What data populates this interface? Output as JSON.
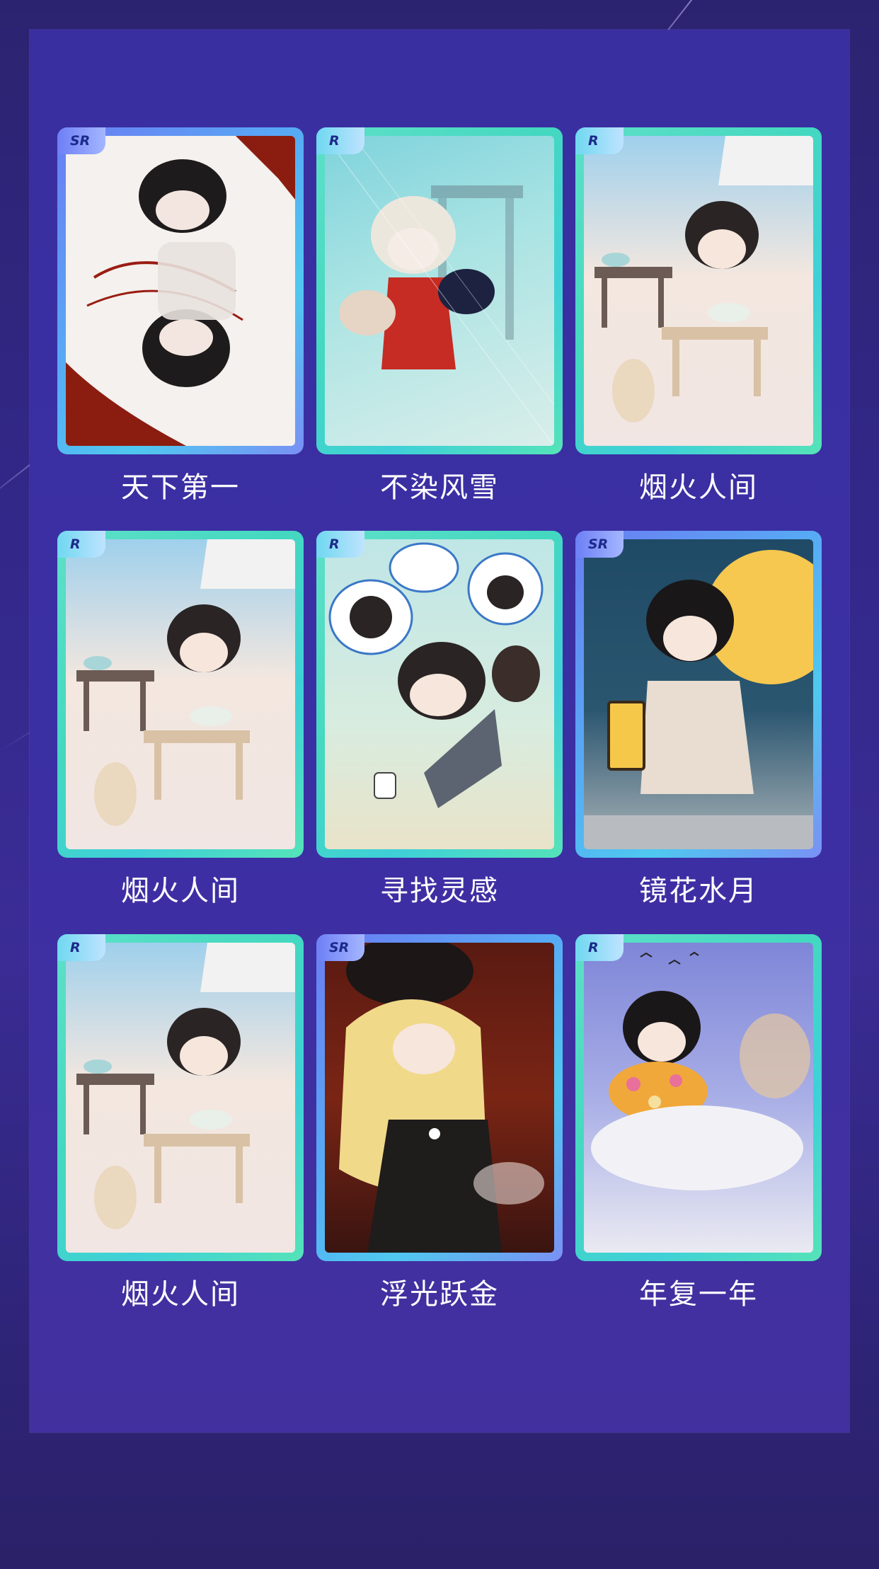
{
  "colors": {
    "background": "#33288a",
    "panel": "#3b2fa4",
    "card_r_border": "#44d8c0",
    "card_sr_border": "#58a8f5",
    "title_text": "#ffffff"
  },
  "cards": [
    {
      "rarity": "SR",
      "title": "天下第一",
      "art": "ink-swordsman-illustration"
    },
    {
      "rarity": "R",
      "title": "不染风雪",
      "art": "white-haired-girl-illustration"
    },
    {
      "rarity": "R",
      "title": "烟火人间",
      "art": "dining-boy-with-cat-illustration"
    },
    {
      "rarity": "R",
      "title": "烟火人间",
      "art": "dining-boy-with-cat-illustration"
    },
    {
      "rarity": "R",
      "title": "寻找灵感",
      "art": "boy-at-laptop-illustration"
    },
    {
      "rarity": "SR",
      "title": "镜花水月",
      "art": "moon-lantern-girl-illustration"
    },
    {
      "rarity": "R",
      "title": "烟火人间",
      "art": "dining-boy-with-cat-illustration"
    },
    {
      "rarity": "SR",
      "title": "浮光跃金",
      "art": "golden-haired-figure-illustration"
    },
    {
      "rarity": "R",
      "title": "年复一年",
      "art": "boy-with-flowers-illustration"
    }
  ]
}
